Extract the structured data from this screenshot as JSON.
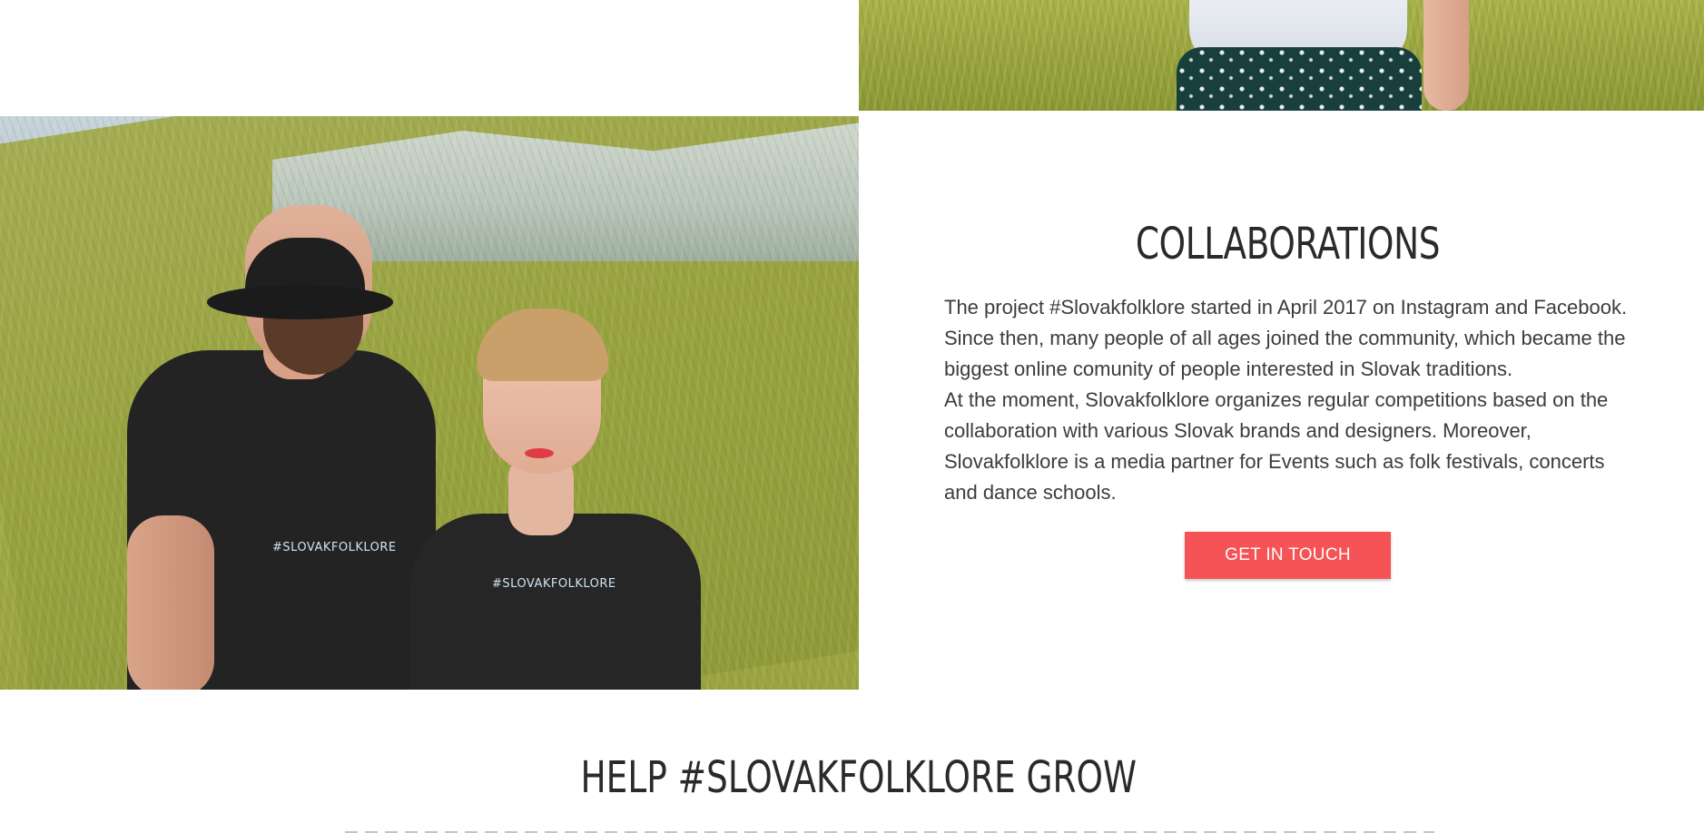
{
  "collaborations": {
    "title": "COLLABORATIONS",
    "paragraphs": [
      "The project #Slovakfolklore started in April 2017 on Instagram and Facebook. Since then, many people of all ages joined the community, which became the biggest online comunity of people interested in Slovak traditions.",
      "At the moment, Slovakfolklore organizes regular competitions based on the collaboration with various Slovak brands and designers. Moreover, Slovakfolklore is a media partner for Events such as folk festivals, concerts and dance schools."
    ],
    "cta_label": "GET IN TOUCH"
  },
  "photo": {
    "shirt_print_man": "#SLOVAKFOLKLORE",
    "shirt_print_woman": "#SLOVAKFOLKLORE"
  },
  "help_section": {
    "title": "HELP #SLOVAKFOLKLORE GROW"
  },
  "colors": {
    "accent": "#f65356",
    "heading": "#2a2a2a",
    "body_text": "#3c3c3c"
  }
}
